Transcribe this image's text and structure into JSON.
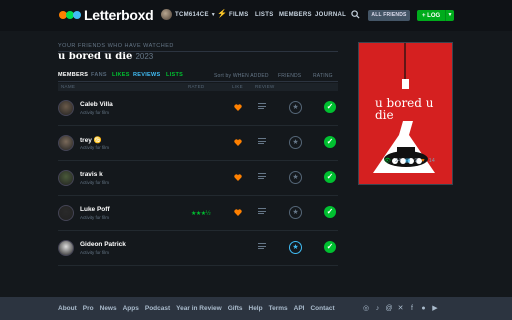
{
  "header": {
    "logo": "Letterboxd",
    "username": "TCM614CE",
    "nav": [
      "FILMS",
      "LISTS",
      "MEMBERS",
      "JOURNAL"
    ],
    "friends_button": "ALL FRIENDS",
    "log_button": "+ LOG"
  },
  "film": {
    "kicker": "YOUR FRIENDS WHO HAVE WATCHED",
    "title": "u bored u die",
    "year": "2023",
    "poster_title": "u bored u die",
    "stats": {
      "watched": "24",
      "lists": "9",
      "likes": "14"
    }
  },
  "tabs": {
    "items": [
      "MEMBERS",
      "FANS",
      "LIKES",
      "REVIEWS",
      "LISTS"
    ],
    "active": "MEMBERS",
    "sort_label": "Sort by WHEN ADDED",
    "friends_filter": "FRIENDS",
    "rating_filter": "RATING"
  },
  "columns": {
    "name": "NAME",
    "rated": "RATED",
    "like": "LIKE",
    "review": "REVIEW"
  },
  "rows": [
    {
      "name": "Caleb Villa",
      "sub": "Activity for film",
      "stars": "",
      "liked": true,
      "reviewed": true,
      "fav": false
    },
    {
      "name": "trey ♋",
      "sub": "Activity for film",
      "stars": "",
      "liked": true,
      "reviewed": true,
      "fav": false
    },
    {
      "name": "travis k",
      "sub": "Activity for film",
      "stars": "",
      "liked": true,
      "reviewed": true,
      "fav": false
    },
    {
      "name": "Luke Poff",
      "sub": "Activity for film",
      "stars": "★★★½",
      "liked": true,
      "reviewed": true,
      "fav": false
    },
    {
      "name": "Gideon Patrick",
      "sub": "Activity for film",
      "stars": "",
      "liked": false,
      "reviewed": true,
      "fav": true
    }
  ],
  "footer": {
    "links": [
      "About",
      "Pro",
      "News",
      "Apps",
      "Podcast",
      "Year in Review",
      "Gifts",
      "Help",
      "Terms",
      "API",
      "Contact"
    ],
    "socials": [
      "instagram-icon",
      "tiktok-icon",
      "threads-icon",
      "x-icon",
      "facebook-icon",
      "patreon-icon",
      "youtube-icon"
    ]
  },
  "colors": {
    "accent_green": "#00c030",
    "brand_orange": "#ff8000",
    "brand_blue": "#40bcf4",
    "poster_red": "#d52020"
  }
}
